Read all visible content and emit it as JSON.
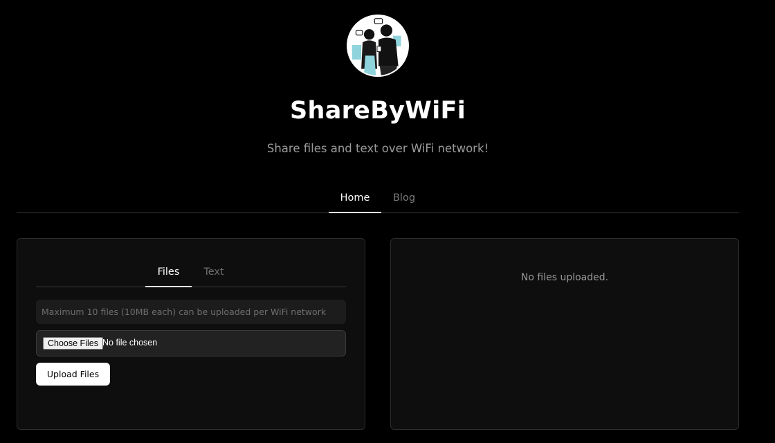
{
  "header": {
    "title": "ShareByWiFi",
    "subtitle": "Share files and text over WiFi network!",
    "avatar_icon": "people-sharing-illustration"
  },
  "nav": {
    "tabs": [
      {
        "label": "Home",
        "active": true
      },
      {
        "label": "Blog",
        "active": false
      }
    ]
  },
  "upload_panel": {
    "tabs": [
      {
        "label": "Files",
        "active": true
      },
      {
        "label": "Text",
        "active": false
      }
    ],
    "info": "Maximum 10 files (10MB each) can be uploaded per WiFi network",
    "file_input": {
      "button_label": "Choose Files",
      "status": "No file chosen"
    },
    "upload_button": "Upload Files"
  },
  "files_panel": {
    "empty_message": "No files uploaded."
  },
  "colors": {
    "background": "#000000",
    "card": "#0e0e0e",
    "border": "#2c2c2c",
    "muted_text": "#9a9a9a"
  }
}
